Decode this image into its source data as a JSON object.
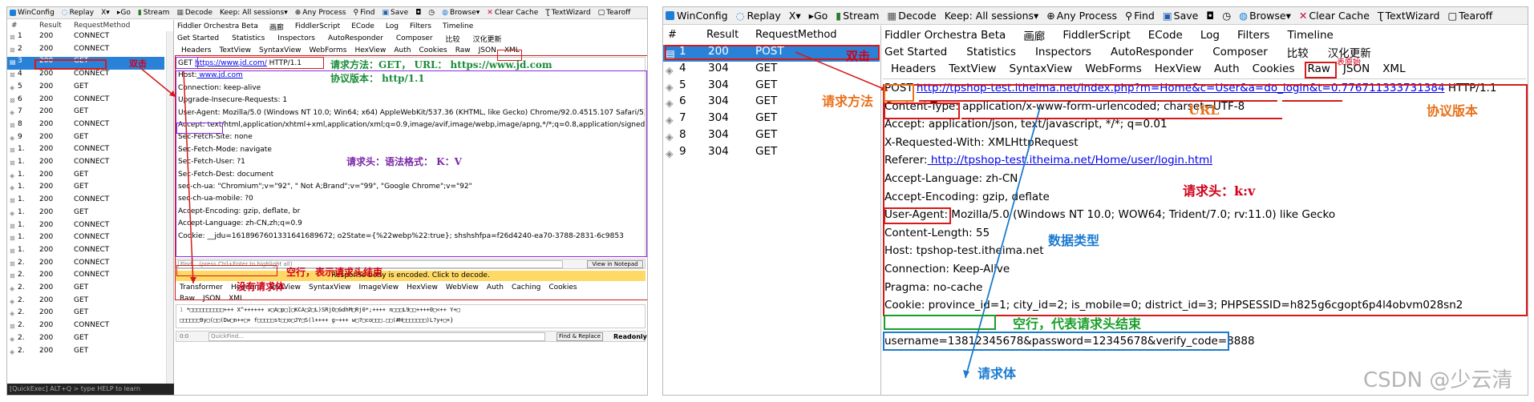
{
  "left": {
    "toolbar": {
      "winconfig": "WinConfig",
      "replay": "Replay",
      "remove": "X",
      "go": "Go",
      "stream": "Stream",
      "decode": "Decode",
      "keep": "Keep: All sessions",
      "process": "Any Process",
      "find": "Find",
      "save": "Save",
      "browse": "Browse",
      "clear_cache": "Clear Cache",
      "textwizard": "TextWizard",
      "tearoff": "Tearoff"
    },
    "session_headers": {
      "num": "#",
      "result": "Result",
      "method": "RequestMethod"
    },
    "sessions": [
      {
        "num": "1",
        "result": "200",
        "method": "CONNECT"
      },
      {
        "num": "2",
        "result": "200",
        "method": "CONNECT"
      },
      {
        "num": "3",
        "result": "200",
        "method": "GET"
      },
      {
        "num": "4",
        "result": "200",
        "method": "CONNECT"
      },
      {
        "num": "5",
        "result": "200",
        "method": "GET"
      },
      {
        "num": "6",
        "result": "200",
        "method": "CONNECT"
      },
      {
        "num": "7",
        "result": "200",
        "method": "GET"
      },
      {
        "num": "8",
        "result": "200",
        "method": "CONNECT"
      },
      {
        "num": "9",
        "result": "200",
        "method": "GET"
      },
      {
        "num": "1.",
        "result": "200",
        "method": "CONNECT"
      },
      {
        "num": "1.",
        "result": "200",
        "method": "CONNECT"
      },
      {
        "num": "1.",
        "result": "200",
        "method": "GET"
      },
      {
        "num": "1.",
        "result": "200",
        "method": "GET"
      },
      {
        "num": "1.",
        "result": "200",
        "method": "CONNECT"
      },
      {
        "num": "1.",
        "result": "200",
        "method": "GET"
      },
      {
        "num": "1.",
        "result": "200",
        "method": "CONNECT"
      },
      {
        "num": "1.",
        "result": "200",
        "method": "CONNECT"
      },
      {
        "num": "1.",
        "result": "200",
        "method": "CONNECT"
      },
      {
        "num": "2.",
        "result": "200",
        "method": "CONNECT"
      },
      {
        "num": "2.",
        "result": "200",
        "method": "CONNECT"
      },
      {
        "num": "2.",
        "result": "200",
        "method": "GET"
      },
      {
        "num": "2.",
        "result": "200",
        "method": "GET"
      },
      {
        "num": "2.",
        "result": "200",
        "method": "GET"
      },
      {
        "num": "2.",
        "result": "200",
        "method": "CONNECT"
      },
      {
        "num": "2.",
        "result": "200",
        "method": "GET"
      },
      {
        "num": "2.",
        "result": "200",
        "method": "GET"
      }
    ],
    "quickexec": "[QuickExec] ALT+Q > type HELP to learn",
    "tabs_row1": [
      "Fiddler Orchestra Beta",
      "画廊",
      "FiddlerScript",
      "ECode",
      "Log",
      "Filters",
      "Timeline"
    ],
    "tabs_row2": [
      "Get Started",
      "Statistics",
      "Inspectors",
      "AutoResponder",
      "Composer",
      "比较",
      "汉化更新"
    ],
    "tabs_row3": [
      "Headers",
      "TextView",
      "SyntaxView",
      "WebForms",
      "HexView",
      "Auth",
      "Cookies",
      "Raw",
      "JSON",
      "XML"
    ],
    "request": {
      "method": "GET",
      "url": "https://www.jd.com/",
      "version": "HTTP/1.1",
      "lines": [
        {
          "name": "Host:",
          "value": " www.jd.com",
          "link": true
        },
        {
          "name": "Connection:",
          "value": " keep-alive"
        },
        {
          "name": "Upgrade-Insecure-Requests:",
          "value": " 1"
        },
        {
          "name": "User-Agent:",
          "value": " Mozilla/5.0 (Windows NT 10.0; Win64; x64) AppleWebKit/537.36 (KHTML, like Gecko) Chrome/92.0.4515.107 Safari/537.36"
        },
        {
          "name": "Accept:",
          "value": " text/html,application/xhtml+xml,application/xml;q=0.9,image/avif,image/webp,image/apng,*/*;q=0.8,application/signed-exchange"
        },
        {
          "name": "Sec-Fetch-Site:",
          "value": " none"
        },
        {
          "name": "Sec-Fetch-Mode:",
          "value": " navigate"
        },
        {
          "name": "Sec-Fetch-User:",
          "value": " ?1"
        },
        {
          "name": "Sec-Fetch-Dest:",
          "value": " document"
        },
        {
          "name": "sec-ch-ua:",
          "value": " \"Chromium\";v=\"92\", \" Not A;Brand\";v=\"99\", \"Google Chrome\";v=\"92\""
        },
        {
          "name": "sec-ch-ua-mobile:",
          "value": " ?0"
        },
        {
          "name": "Accept-Encoding:",
          "value": " gzip, deflate, br"
        },
        {
          "name": "Accept-Language:",
          "value": " zh-CN,zh;q=0.9"
        },
        {
          "name": "Cookie:",
          "value": " __jdu=1618967601331641689672; o2State={%22webp%22:true}; shshshfpa=f26d4240-ea70-3788-2831-6c9853"
        }
      ]
    },
    "find_placeholder": "Find... (press Ctrl+Enter to highlight all)",
    "view_notepad": "View in Notepad",
    "response_banner": "Response body is encoded. Click to decode.",
    "resp_tabs1": [
      "Transformer",
      "Headers",
      "TextView",
      "SyntaxView",
      "ImageView",
      "HexView",
      "WebView",
      "Auth",
      "Caching",
      "Cookies"
    ],
    "resp_tabs2": [
      "Raw",
      "JSON",
      "XML"
    ],
    "garbled1": "*□□□□□□□□□□+++    X^++++++    x□A□p□]□KCA□2□L)SRjO□GdhM□Rj0*;++++   n□□□L9□□++++0□<++   Y+□",
    "garbled2": "□□□□□□9y□(□□(Dw□n++□+ f□□□□□st□□o□JY□S(l++++ g~+++   w□?□co□□□.□□(#H□□□□□□□)L?y+□+}",
    "quickfind": "QuickFind...",
    "find_replace": "Find & Replace",
    "readonly": "Readonly",
    "annotations": {
      "double_click": "双击",
      "method_url": "请求方法：GET， URL： https://www.jd.com",
      "protocol": "协议版本： http/1.1",
      "headers_fmt": "请求头：语法格式： K：V",
      "blank_line": "空行，表示请求头结束",
      "no_body": "没有请求体"
    }
  },
  "right": {
    "toolbar": {
      "winconfig": "WinConfig",
      "replay": "Replay",
      "remove": "X",
      "go": "Go",
      "stream": "Stream",
      "decode": "Decode",
      "keep": "Keep: All sessions",
      "process": "Any Process",
      "find": "Find",
      "save": "Save",
      "browse": "Browse",
      "clear_cache": "Clear Cache",
      "textwizard": "TextWizard",
      "tearoff": "Tearoff"
    },
    "session_headers": {
      "num": "#",
      "result": "Result",
      "method": "RequestMethod"
    },
    "sessions": [
      {
        "num": "1",
        "result": "200",
        "method": "POST"
      },
      {
        "num": "4",
        "result": "304",
        "method": "GET"
      },
      {
        "num": "5",
        "result": "304",
        "method": "GET"
      },
      {
        "num": "6",
        "result": "304",
        "method": "GET"
      },
      {
        "num": "7",
        "result": "304",
        "method": "GET"
      },
      {
        "num": "8",
        "result": "304",
        "method": "GET"
      },
      {
        "num": "9",
        "result": "304",
        "method": "GET"
      }
    ],
    "tabs_row1": [
      "Fiddler Orchestra Beta",
      "画廊",
      "FiddlerScript",
      "ECode",
      "Log",
      "Filters",
      "Timeline"
    ],
    "tabs_row2": [
      "Get Started",
      "Statistics",
      "Inspectors",
      "AutoResponder",
      "Composer",
      "比较",
      "汉化更新"
    ],
    "tabs_row3": [
      "Headers",
      "TextView",
      "SyntaxView",
      "WebForms",
      "HexView",
      "Auth",
      "Cookies",
      "Raw",
      "JSON",
      "XML"
    ],
    "request": {
      "method": "POST",
      "url": "http://tpshop-test.itheima.net/index.php?m=Home&c=User&a=do_login&t=0.776711333731384",
      "version": "HTTP/1.1",
      "lines": [
        {
          "name": "Content-Type:",
          "value": " application/x-www-form-urlencoded; charset=UTF-8"
        },
        {
          "name": "Accept:",
          "value": " application/json, text/javascript, */*; q=0.01"
        },
        {
          "name": "X-Requested-With:",
          "value": " XMLHttpRequest"
        },
        {
          "name": "Referer:",
          "value": " http://tpshop-test.itheima.net/Home/user/login.html",
          "link": true
        },
        {
          "name": "Accept-Language:",
          "value": " zh-CN"
        },
        {
          "name": "Accept-Encoding:",
          "value": " gzip, deflate"
        },
        {
          "name": "User-Agent:",
          "value": " Mozilla/5.0 (Windows NT 10.0; WOW64; Trident/7.0; rv:11.0) like Gecko"
        },
        {
          "name": "Content-Length:",
          "value": " 55"
        },
        {
          "name": "Host:",
          "value": " tpshop-test.itheima.net"
        },
        {
          "name": "Connection:",
          "value": " Keep-Alive"
        },
        {
          "name": "Pragma:",
          "value": " no-cache"
        },
        {
          "name": "Cookie:",
          "value": " province_id=1; city_id=2; is_mobile=0; district_id=3; PHPSESSID=h825g6cgopt6p4l4obvm028sn2"
        }
      ],
      "body": "username=13812345678&password=12345678&verify_code=8888"
    },
    "annotations": {
      "double_click": "双击",
      "raw_hint": "表原始",
      "method": "请求方法",
      "url": "URL",
      "protocol": "协议版本",
      "headers": "请求头：k:v",
      "content_type": "数据类型",
      "blank_line": "空行，代表请求头结束",
      "body": "请求体"
    }
  },
  "watermark": "CSDN @少云清"
}
